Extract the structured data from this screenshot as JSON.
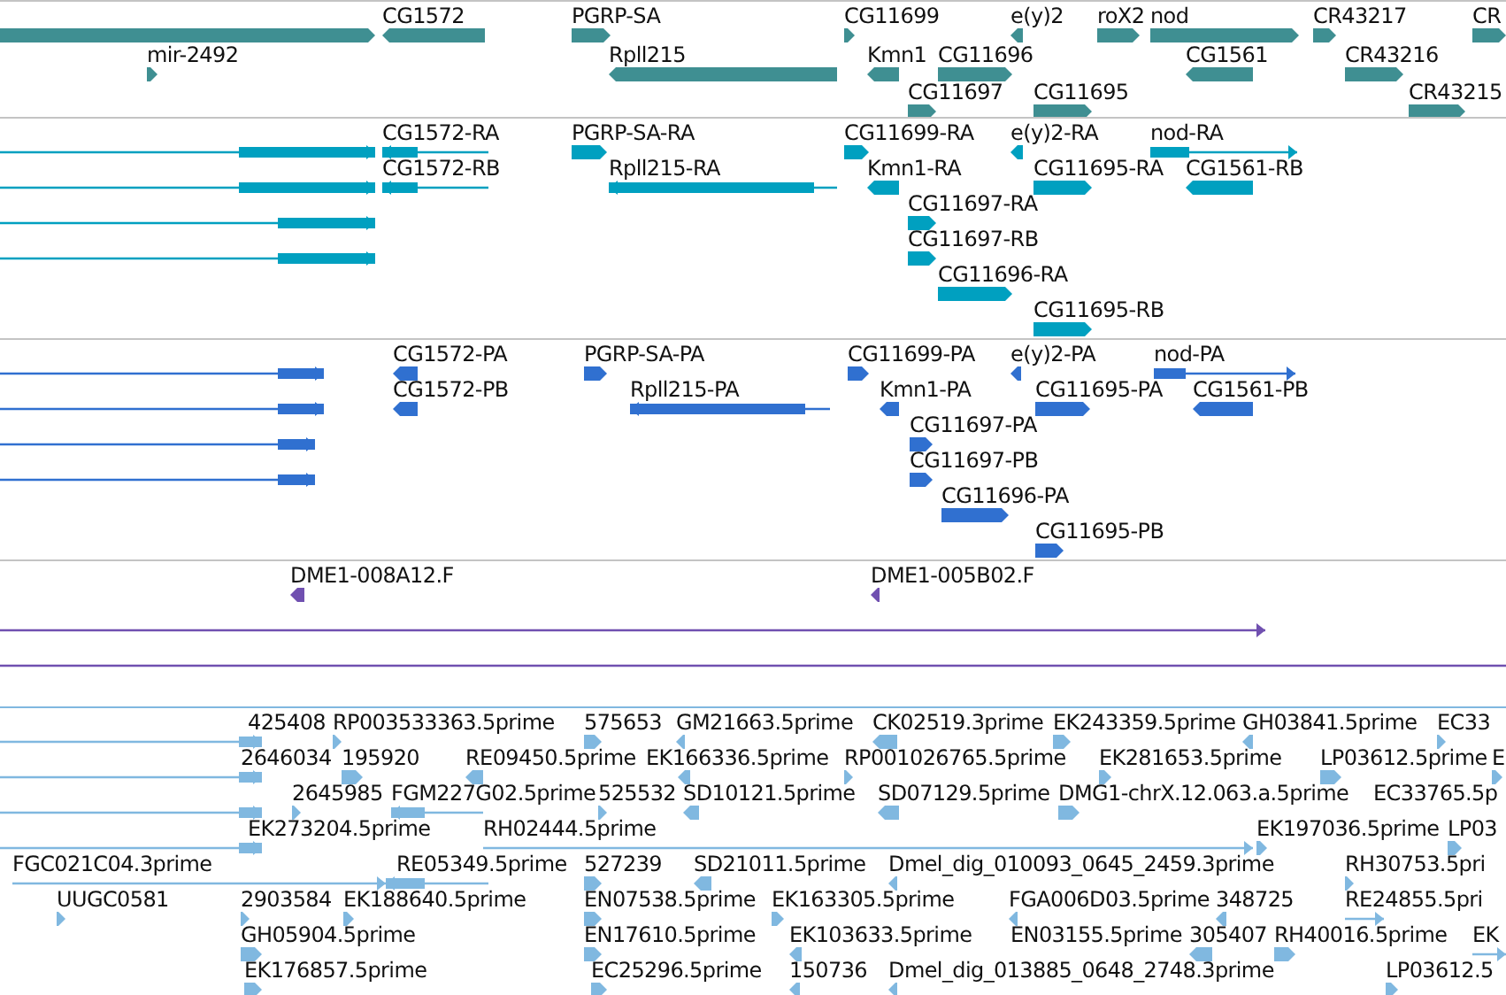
{
  "tracks": [
    {
      "kind": "gene",
      "color": "#3f8f92",
      "features": [
        {
          "reverse": false
        },
        {
          "label": "CG1572",
          "reverse": true
        },
        {
          "label": "PGRP-SA",
          "reverse": false
        },
        {
          "label": "mir-2492",
          "reverse": false
        },
        {
          "label": "Rpll215",
          "reverse": true
        },
        {
          "label": "CG11699",
          "reverse": false
        },
        {
          "label": "e(y)2",
          "reverse": true
        },
        {
          "label": "roX2",
          "reverse": false
        },
        {
          "label": "nod",
          "reverse": false
        },
        {
          "label": "CR43217",
          "reverse": false
        },
        {
          "label": "CR",
          "reverse": false
        },
        {
          "label": "Kmn1",
          "reverse": true
        },
        {
          "label": "CG11696",
          "reverse": false
        },
        {
          "label": "CG1561",
          "reverse": true
        },
        {
          "label": "CR43216",
          "reverse": false
        },
        {
          "label": "CG11697",
          "reverse": false
        },
        {
          "label": "CG11695",
          "reverse": false
        },
        {
          "label": "CR43215",
          "reverse": false
        }
      ]
    },
    {
      "kind": "transcript",
      "color": "#00a0c0",
      "features": [
        {
          "reverse": false
        },
        {
          "reverse": false
        },
        {
          "reverse": false
        },
        {
          "reverse": false
        },
        {
          "label": "CG1572-RA",
          "reverse": true
        },
        {
          "label": "CG1572-RB",
          "reverse": true
        },
        {
          "label": "PGRP-SA-RA",
          "reverse": false
        },
        {
          "label": "Rpll215-RA",
          "reverse": true
        },
        {
          "label": "CG11699-RA",
          "reverse": false
        },
        {
          "label": "e(y)2-RA",
          "reverse": true
        },
        {
          "label": "nod-RA",
          "reverse": false
        },
        {
          "label": "Kmn1-RA",
          "reverse": true
        },
        {
          "label": "CG11695-RA",
          "reverse": false
        },
        {
          "label": "CG1561-RB",
          "reverse": true
        },
        {
          "label": "CG11697-RA",
          "reverse": false
        },
        {
          "label": "CG11697-RB",
          "reverse": false
        },
        {
          "label": "CG11696-RA",
          "reverse": false
        },
        {
          "label": "CG11695-RB",
          "reverse": false
        }
      ]
    },
    {
      "kind": "protein",
      "color": "#3070d0",
      "features": [
        {
          "reverse": false
        },
        {
          "reverse": false
        },
        {
          "reverse": false
        },
        {
          "reverse": false
        },
        {
          "label": "CG1572-PA",
          "reverse": true
        },
        {
          "label": "CG1572-PB",
          "reverse": true
        },
        {
          "label": "PGRP-SA-PA",
          "reverse": false
        },
        {
          "label": "Rpll215-PA",
          "reverse": true
        },
        {
          "label": "CG11699-PA",
          "reverse": false
        },
        {
          "label": "e(y)2-PA",
          "reverse": true
        },
        {
          "label": "nod-PA",
          "reverse": false
        },
        {
          "label": "Kmn1-PA",
          "reverse": true
        },
        {
          "label": "CG11695-PA",
          "reverse": false
        },
        {
          "label": "CG1561-PB",
          "reverse": true
        },
        {
          "label": "CG11697-PA",
          "reverse": false
        },
        {
          "label": "CG11697-PB",
          "reverse": false
        },
        {
          "label": "CG11696-PA",
          "reverse": false
        },
        {
          "label": "CG11695-PB",
          "reverse": false
        }
      ]
    },
    {
      "kind": "clone",
      "color": "#7050b0",
      "features": [
        {
          "label": "DME1-008A12.F",
          "reverse": true
        },
        {
          "label": "DME1-005B02.F",
          "reverse": true
        },
        {
          "reverse": false
        },
        {
          "reverse": false
        }
      ]
    },
    {
      "kind": "est",
      "color": "#80b8e0",
      "features": [
        {
          "label": "425408",
          "reverse": false
        },
        {
          "label": "RP003533363.5prime",
          "reverse": false
        },
        {
          "label": "575653",
          "reverse": false
        },
        {
          "label": "GM21663.5prime",
          "reverse": true
        },
        {
          "label": "CK02519.3prime",
          "reverse": true
        },
        {
          "label": "EK243359.5prime",
          "reverse": false
        },
        {
          "label": "GH03841.5prime",
          "reverse": true
        },
        {
          "label": "EC33",
          "reverse": false
        },
        {
          "label": "2646034",
          "reverse": false
        },
        {
          "label": "195920",
          "reverse": false
        },
        {
          "label": "RE09450.5prime",
          "reverse": true
        },
        {
          "label": "EK166336.5prime",
          "reverse": true
        },
        {
          "label": "RP001026765.5prime",
          "reverse": false
        },
        {
          "label": "EK281653.5prime",
          "reverse": false
        },
        {
          "label": "LP03612.5prime",
          "reverse": false
        },
        {
          "label": "E",
          "reverse": false
        },
        {
          "reverse": false
        },
        {
          "label": "2645985",
          "reverse": false
        },
        {
          "label": "FGM227G02.5prime",
          "reverse": true
        },
        {
          "label": "525532",
          "reverse": false
        },
        {
          "label": "SD10121.5prime",
          "reverse": true
        },
        {
          "label": "SD07129.5prime",
          "reverse": true
        },
        {
          "label": "DMG1-chrX.12.063.a.5prime",
          "reverse": false
        },
        {
          "label": "EC33765.5p"
        },
        {
          "label": "EK273204.5prime",
          "reverse": false
        },
        {
          "label": "RH02444.5prime",
          "reverse": false
        },
        {
          "label": "EK197036.5prime",
          "reverse": false
        },
        {
          "label": "LP03",
          "reverse": false
        },
        {
          "label": "FGC021C04.3prime",
          "reverse": false
        },
        {
          "label": "RE05349.5prime",
          "reverse": true
        },
        {
          "label": "527239",
          "reverse": false
        },
        {
          "label": "SD21011.5prime",
          "reverse": true
        },
        {
          "label": "Dmel_dig_010093_0645_2459.3prime",
          "reverse": true
        },
        {
          "label": "RH30753.5pri",
          "reverse": false
        },
        {
          "label": "UUGC0581",
          "reverse": false
        },
        {
          "label": "2903584",
          "reverse": false
        },
        {
          "label": "EK188640.5prime",
          "reverse": false
        },
        {
          "label": "EN07538.5prime",
          "reverse": false
        },
        {
          "label": "EK163305.5prime",
          "reverse": false
        },
        {
          "label": "FGA006D03.5prime",
          "reverse": true
        },
        {
          "label": "348725",
          "reverse": true
        },
        {
          "label": "RE24855.5pri",
          "reverse": false
        },
        {
          "label": "GH05904.5prime",
          "reverse": false
        },
        {
          "label": "EN17610.5prime",
          "reverse": false
        },
        {
          "label": "EK103633.5prime",
          "reverse": true
        },
        {
          "label": "EN03155.5prime"
        },
        {
          "label": "305407",
          "reverse": true
        },
        {
          "label": "RH40016.5prime",
          "reverse": false
        },
        {
          "label": "EK",
          "reverse": false
        },
        {
          "label": "EK176857.5prime",
          "reverse": false
        },
        {
          "label": "EC25296.5prime",
          "reverse": false
        },
        {
          "label": "150736",
          "reverse": true
        },
        {
          "label": "Dmel_dig_013885_0648_2748.3prime",
          "reverse": true
        },
        {
          "label": "LP03612.5",
          "reverse": false
        }
      ]
    }
  ]
}
